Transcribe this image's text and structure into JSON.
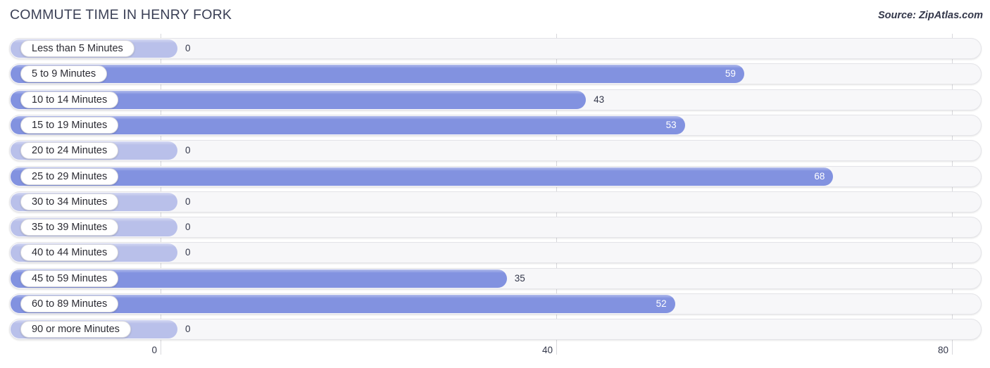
{
  "header": {
    "title": "COMMUTE TIME IN HENRY FORK",
    "source": "Source: ZipAtlas.com"
  },
  "colors": {
    "bar": "#8292e0",
    "bar_zero": "#b9c0ea",
    "track": "#f7f7f9",
    "grid": "#d8d8dc",
    "text": "#33374a"
  },
  "chart_data": {
    "type": "bar",
    "orientation": "horizontal",
    "title": "COMMUTE TIME IN HENRY FORK",
    "xlabel": "",
    "ylabel": "",
    "xlim": [
      0,
      80
    ],
    "ticks": [
      0,
      40,
      80
    ],
    "grid": true,
    "legend": false,
    "categories": [
      "Less than 5 Minutes",
      "5 to 9 Minutes",
      "10 to 14 Minutes",
      "15 to 19 Minutes",
      "20 to 24 Minutes",
      "25 to 29 Minutes",
      "30 to 34 Minutes",
      "35 to 39 Minutes",
      "40 to 44 Minutes",
      "45 to 59 Minutes",
      "60 to 89 Minutes",
      "90 or more Minutes"
    ],
    "values": [
      0,
      59,
      43,
      53,
      0,
      68,
      0,
      0,
      0,
      35,
      52,
      0
    ],
    "value_labels": [
      "0",
      "59",
      "43",
      "53",
      "0",
      "68",
      "0",
      "0",
      "0",
      "35",
      "52",
      "0"
    ]
  },
  "rows": [
    {
      "label": "Less than 5 Minutes",
      "value": 0,
      "value_label": "0",
      "inside": false
    },
    {
      "label": "5 to 9 Minutes",
      "value": 59,
      "value_label": "59",
      "inside": true
    },
    {
      "label": "10 to 14 Minutes",
      "value": 43,
      "value_label": "43",
      "inside": false
    },
    {
      "label": "15 to 19 Minutes",
      "value": 53,
      "value_label": "53",
      "inside": true
    },
    {
      "label": "20 to 24 Minutes",
      "value": 0,
      "value_label": "0",
      "inside": false
    },
    {
      "label": "25 to 29 Minutes",
      "value": 68,
      "value_label": "68",
      "inside": true
    },
    {
      "label": "30 to 34 Minutes",
      "value": 0,
      "value_label": "0",
      "inside": false
    },
    {
      "label": "35 to 39 Minutes",
      "value": 0,
      "value_label": "0",
      "inside": false
    },
    {
      "label": "40 to 44 Minutes",
      "value": 0,
      "value_label": "0",
      "inside": false
    },
    {
      "label": "45 to 59 Minutes",
      "value": 35,
      "value_label": "35",
      "inside": false
    },
    {
      "label": "60 to 89 Minutes",
      "value": 52,
      "value_label": "52",
      "inside": true
    },
    {
      "label": "90 or more Minutes",
      "value": 0,
      "value_label": "0",
      "inside": false
    }
  ],
  "axis": {
    "ticks": [
      {
        "label": "0",
        "value": 0
      },
      {
        "label": "40",
        "value": 40
      },
      {
        "label": "80",
        "value": 80
      }
    ]
  }
}
